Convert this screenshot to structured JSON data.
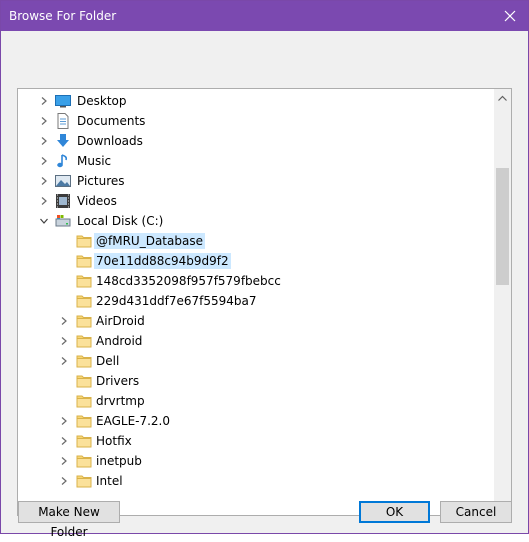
{
  "window": {
    "title": "Browse For Folder"
  },
  "tree": {
    "items": [
      {
        "label": "Desktop",
        "icon": "desktop-icon",
        "level": 1,
        "expander": "collapsed"
      },
      {
        "label": "Documents",
        "icon": "documents-icon",
        "level": 1,
        "expander": "collapsed"
      },
      {
        "label": "Downloads",
        "icon": "downloads-icon",
        "level": 1,
        "expander": "collapsed"
      },
      {
        "label": "Music",
        "icon": "music-icon",
        "level": 1,
        "expander": "collapsed"
      },
      {
        "label": "Pictures",
        "icon": "pictures-icon",
        "level": 1,
        "expander": "collapsed"
      },
      {
        "label": "Videos",
        "icon": "videos-icon",
        "level": 1,
        "expander": "collapsed"
      },
      {
        "label": "Local Disk (C:)",
        "icon": "local-disk-icon",
        "level": 1,
        "expander": "expanded"
      },
      {
        "label": "@fMRU_Database",
        "icon": "folder-icon",
        "level": 2,
        "expander": "none",
        "selected": true
      },
      {
        "label": "70e11dd88c94b9d9f2",
        "icon": "folder-icon",
        "level": 2,
        "expander": "none",
        "highlighted": true
      },
      {
        "label": "148cd3352098f957f579fbebcc",
        "icon": "folder-icon",
        "level": 2,
        "expander": "none"
      },
      {
        "label": "229d431ddf7e67f5594ba7",
        "icon": "folder-icon",
        "level": 2,
        "expander": "none"
      },
      {
        "label": "AirDroid",
        "icon": "folder-icon",
        "level": 2,
        "expander": "collapsed"
      },
      {
        "label": "Android",
        "icon": "folder-icon",
        "level": 2,
        "expander": "collapsed"
      },
      {
        "label": "Dell",
        "icon": "folder-icon",
        "level": 2,
        "expander": "collapsed"
      },
      {
        "label": "Drivers",
        "icon": "folder-icon",
        "level": 2,
        "expander": "none"
      },
      {
        "label": "drvrtmp",
        "icon": "folder-icon",
        "level": 2,
        "expander": "none"
      },
      {
        "label": "EAGLE-7.2.0",
        "icon": "folder-icon",
        "level": 2,
        "expander": "collapsed"
      },
      {
        "label": "Hotfix",
        "icon": "folder-icon",
        "level": 2,
        "expander": "collapsed"
      },
      {
        "label": "inetpub",
        "icon": "folder-icon",
        "level": 2,
        "expander": "collapsed"
      },
      {
        "label": "Intel",
        "icon": "folder-icon",
        "level": 2,
        "expander": "collapsed"
      }
    ]
  },
  "buttons": {
    "make_new_folder": "Make New Folder",
    "ok": "OK",
    "cancel": "Cancel"
  },
  "colors": {
    "titlebar": "#7b49b0",
    "selection": "#cce8ff",
    "folder": "#f8d775",
    "default_border": "#0078d7"
  }
}
